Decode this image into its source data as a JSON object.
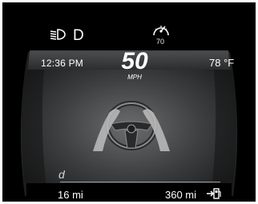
{
  "status_bar": {
    "gear": "D",
    "cruise_set_speed": "70",
    "icons": [
      "headlamp-icon",
      "cruise-control-icon"
    ]
  },
  "info_bar": {
    "time": "12:36 PM",
    "speed": "50",
    "speed_unit": "MPH",
    "outside_temp": "78 °F"
  },
  "center": {
    "icon": "hands-on-steering-wheel-icon"
  },
  "bottom": {
    "odometer_label": "d",
    "trip_distance": "16 mi",
    "range": "360 mi",
    "range_icon": "fuel-arrow-icon"
  }
}
